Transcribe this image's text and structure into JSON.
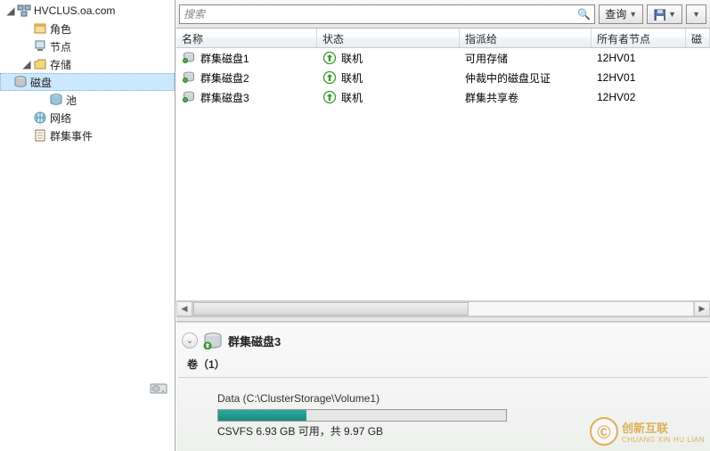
{
  "tree": {
    "root": "HVCLUS.oa.com",
    "roles": "角色",
    "nodes": "节点",
    "storage": "存储",
    "disks": "磁盘",
    "pools": "池",
    "network": "网络",
    "events": "群集事件"
  },
  "toolbar": {
    "search_placeholder": "搜索",
    "query_label": "查询",
    "save_label": ""
  },
  "columns": {
    "name": "名称",
    "status": "状态",
    "assigned": "指派给",
    "owner": "所有者节点",
    "disk": "磁盘"
  },
  "status_online": "联机",
  "rows": [
    {
      "name": "群集磁盘1",
      "assigned": "可用存储",
      "owner": "12HV01"
    },
    {
      "name": "群集磁盘2",
      "assigned": "仲裁中的磁盘见证",
      "owner": "12HV01"
    },
    {
      "name": "群集磁盘3",
      "assigned": "群集共享卷",
      "owner": "12HV02"
    }
  ],
  "detail": {
    "title": "群集磁盘3",
    "volumes_label": "卷（1）",
    "volume_path": "Data (C:\\ClusterStorage\\Volume1)",
    "volume_usage": "CSVFS 6.93 GB 可用，共 9.97 GB",
    "used_fraction": 0.305
  },
  "watermark": {
    "big": "创新互联",
    "small": "CHUANG XIN HU LIAN"
  }
}
